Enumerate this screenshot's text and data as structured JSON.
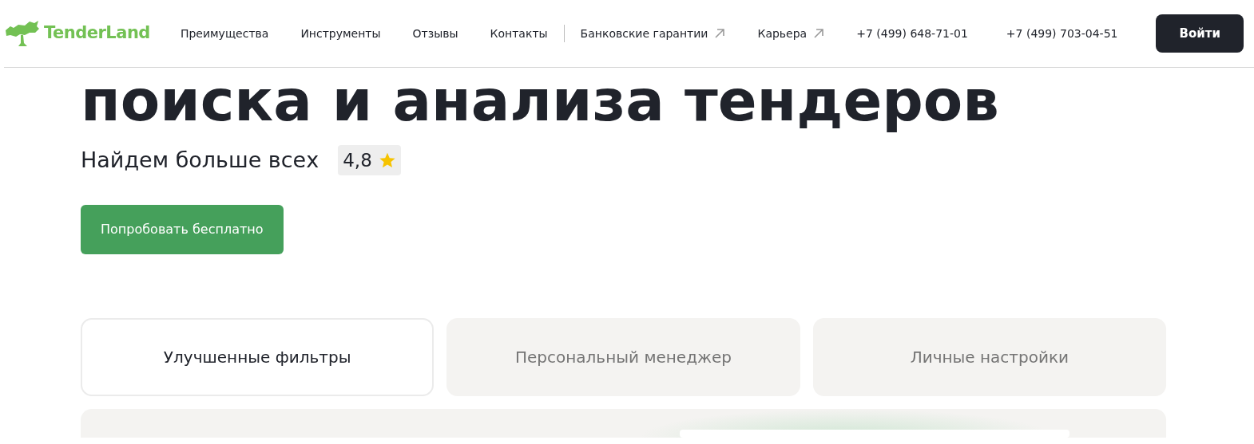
{
  "header": {
    "logo": "TenderLand",
    "nav": [
      {
        "label": "Преимущества",
        "external": false
      },
      {
        "label": "Инструменты",
        "external": false
      },
      {
        "label": "Отзывы",
        "external": false
      },
      {
        "label": "Контакты",
        "external": false
      },
      {
        "label": "Банковские гарантии",
        "external": true
      },
      {
        "label": "Карьера",
        "external": true
      }
    ],
    "phones": [
      "+7 (499) 648-71-01",
      "+7 (499) 703-04-51"
    ],
    "login": "Войти"
  },
  "hero": {
    "title": "поиска и анализа тендеров",
    "subtitle": "Найдем больше всех",
    "rating": "4,8",
    "cta": "Попробовать бесплатно"
  },
  "tabs": [
    {
      "label": "Улучшенные фильтры",
      "selected": true
    },
    {
      "label": "Персональный менеджер",
      "selected": false
    },
    {
      "label": "Личные настройки",
      "selected": false
    }
  ]
}
